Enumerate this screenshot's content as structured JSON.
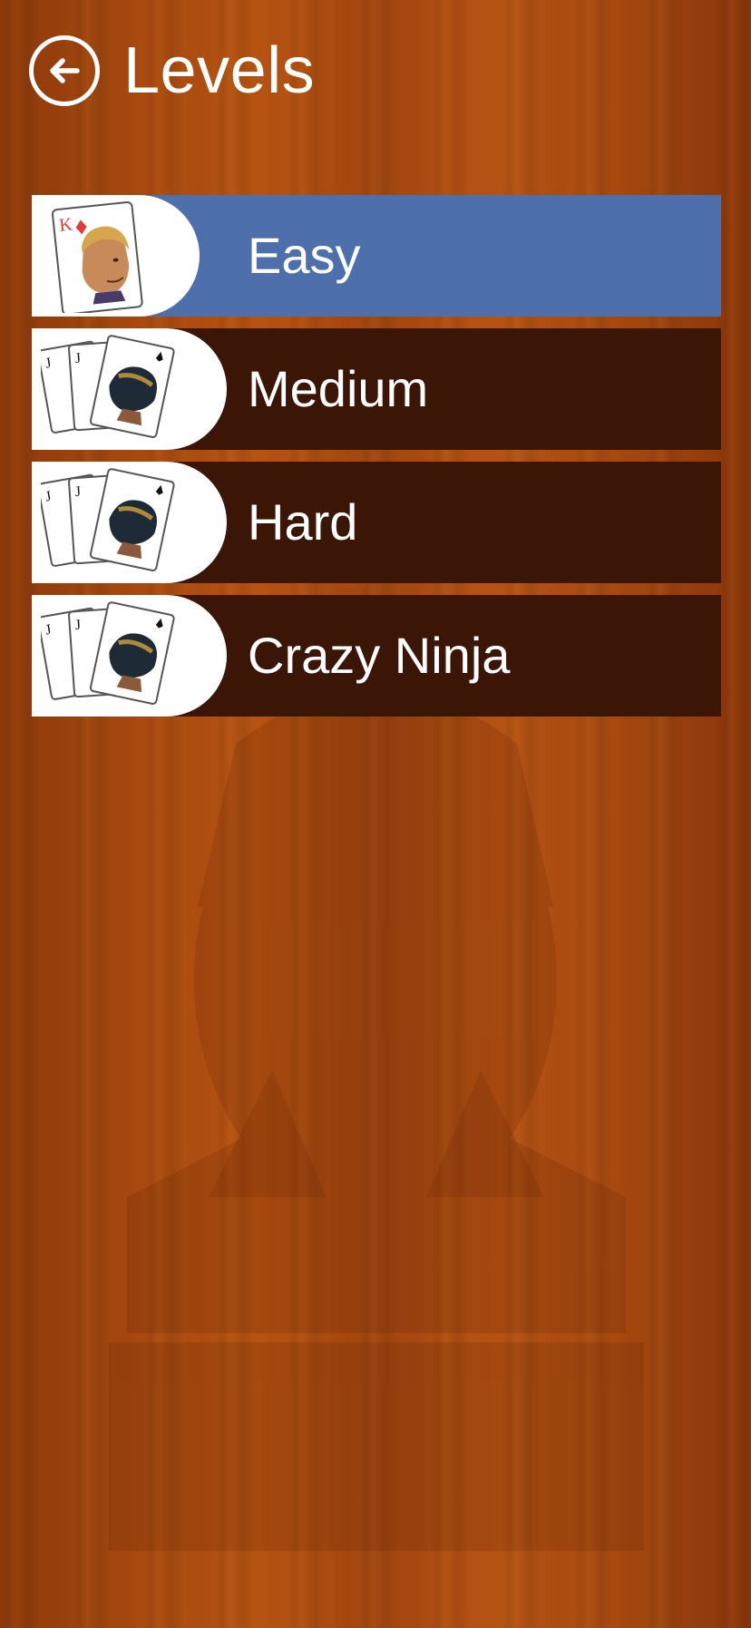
{
  "header": {
    "title": "Levels",
    "back_icon": "arrow-left-circle-icon"
  },
  "levels": [
    {
      "label": "Easy",
      "selected": true,
      "icon": "king-of-diamonds-card-icon",
      "card_rank": "K"
    },
    {
      "label": "Medium",
      "selected": false,
      "icon": "ninja-cards-stack-icon",
      "card_rank": "J"
    },
    {
      "label": "Hard",
      "selected": false,
      "icon": "ninja-cards-stack-icon",
      "card_rank": "J"
    },
    {
      "label": "Crazy Ninja",
      "selected": false,
      "icon": "ninja-cards-stack-icon",
      "card_rank": "J"
    }
  ],
  "colors": {
    "selected_row": "#4d6fab",
    "row": "#3b1506",
    "background_wood": "#a84a10",
    "diamond_red": "#e23a3a"
  }
}
